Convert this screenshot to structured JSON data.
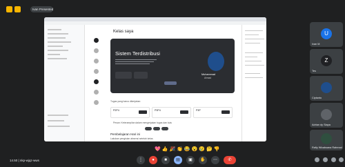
{
  "top_bar": {
    "meeting_pill": "Ivan Presented"
  },
  "screen": {
    "page_title": "Kelas saya",
    "hero": {
      "course_title": "Sistem Terdistribusi",
      "teacher_name": "Muhammad",
      "teacher_sub": "Ahmad"
    },
    "tasks_label": "Tugas yang harus dikerjakan",
    "cards": [
      {
        "code": "P2P4",
        "button": "Lihat"
      },
      {
        "code": "P3P4",
        "button": "Lihat"
      },
      {
        "code": "P3P",
        "button": "Lihat"
      }
    ],
    "notice": "Pesan: Keterampilan dalam mengerjakan tugas dan kuis",
    "lecture_title": "Pembelajaran Hari ini",
    "lecture_sub": "Lakukan pengisian absensi setelah kelas"
  },
  "participants": [
    {
      "name": "Ivan M",
      "initial": "U",
      "color": "#1a73e8"
    },
    {
      "name": "Tes",
      "initial": "Z",
      "color": "#202124"
    },
    {
      "name": "Ciptanto",
      "initial": "",
      "color": "#1f4e8c"
    },
    {
      "name": "Adrian dy Siapa",
      "initial": "",
      "color": "#5f6368"
    },
    {
      "name": "Rafiy Wicaksana Rahmad",
      "initial": "",
      "color": "#2f4f3f"
    }
  ],
  "reactions": [
    "💖",
    "👍",
    "🎉",
    "👏",
    "😂",
    "😮",
    "😢",
    "🤔",
    "👎"
  ],
  "bottom_bar": {
    "clock": "14.50 | nkp-wjqz-wws"
  },
  "colors": {
    "accent": "#f7b500",
    "hangup": "#ea4335",
    "presenting": "#1a73e8"
  }
}
